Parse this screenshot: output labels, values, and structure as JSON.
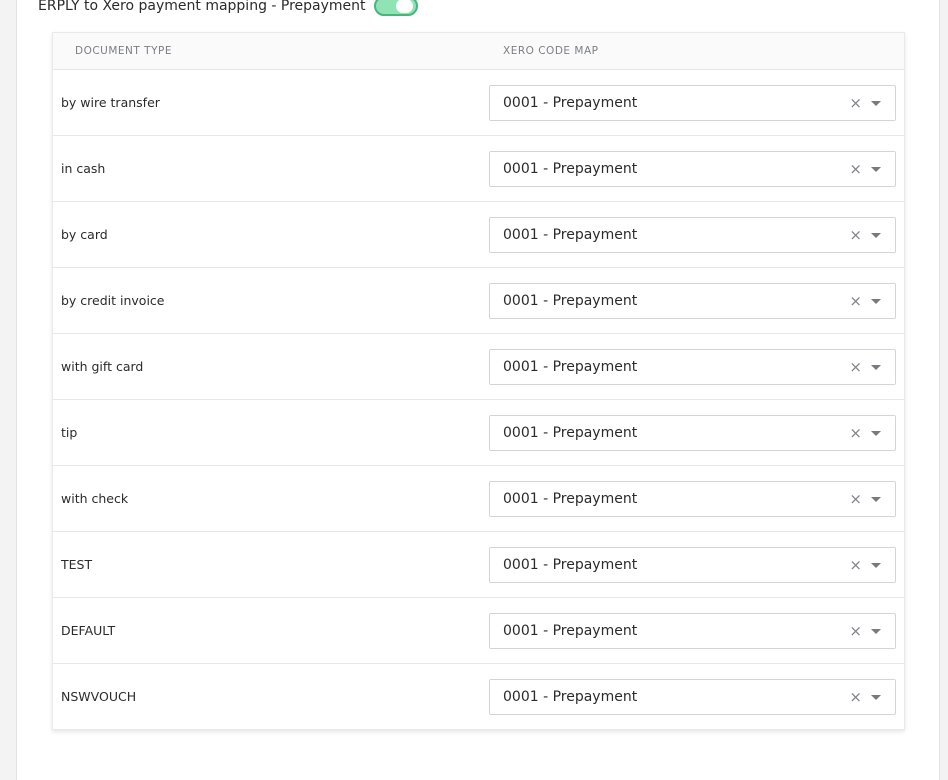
{
  "section": {
    "title": "ERPLY to Xero payment mapping - Prepayment",
    "toggle_on": true
  },
  "table": {
    "headers": [
      "DOCUMENT TYPE",
      "XERO CODE MAP"
    ],
    "rows": [
      {
        "type": "by wire transfer",
        "code": "0001 - Prepayment"
      },
      {
        "type": "in cash",
        "code": "0001 - Prepayment"
      },
      {
        "type": "by card",
        "code": "0001 - Prepayment"
      },
      {
        "type": "by credit invoice",
        "code": "0001 - Prepayment"
      },
      {
        "type": "with gift card",
        "code": "0001 - Prepayment"
      },
      {
        "type": "tip",
        "code": "0001 - Prepayment"
      },
      {
        "type": "with check",
        "code": "0001 - Prepayment"
      },
      {
        "type": "TEST",
        "code": "0001 - Prepayment"
      },
      {
        "type": "DEFAULT",
        "code": "0001 - Prepayment"
      },
      {
        "type": "NSWVOUCH",
        "code": "0001 - Prepayment"
      }
    ]
  },
  "icons": {
    "clear": "close-icon",
    "dropdown": "chevron-down-icon"
  },
  "colors": {
    "toggle_border": "#48b57c",
    "toggle_fill": "#8fe3b5"
  }
}
